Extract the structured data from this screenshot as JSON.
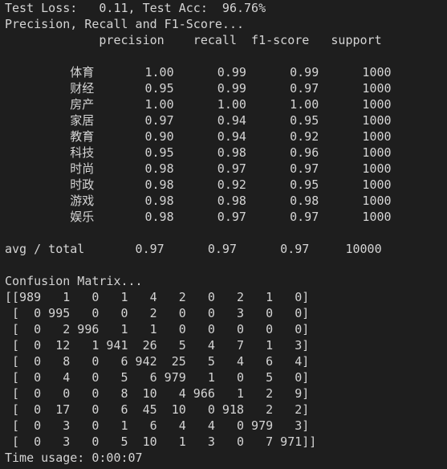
{
  "terminal": {
    "lines": [
      "Test Loss:   0.11, Test Acc:  96.76%",
      "Precision, Recall and F1-Score...",
      "             precision    recall  f1-score   support",
      "",
      "         体育       1.00      0.99      0.99      1000",
      "         财经       0.95      0.99      0.97      1000",
      "         房产       1.00      1.00      1.00      1000",
      "         家居       0.97      0.94      0.95      1000",
      "         教育       0.90      0.94      0.92      1000",
      "         科技       0.95      0.98      0.96      1000",
      "         时尚       0.98      0.97      0.97      1000",
      "         时政       0.98      0.92      0.95      1000",
      "         游戏       0.98      0.98      0.98      1000",
      "         娱乐       0.98      0.97      0.97      1000",
      "",
      "avg / total       0.97      0.97      0.97     10000",
      "",
      "Confusion Matrix...",
      "[[989   1   0   1   4   2   0   2   1   0]",
      " [  0 995   0   0   2   0   0   3   0   0]",
      " [  0   2 996   1   1   0   0   0   0   0]",
      " [  0  12   1 941  26   5   4   7   1   3]",
      " [  0   8   0   6 942  25   5   4   6   4]",
      " [  0   4   0   5   6 979   1   0   5   0]",
      " [  0   0   0   8  10   4 966   1   2   9]",
      " [  0  17   0   6  45  10   0 918   2   2]",
      " [  0   3   0   1   6   4   4   0 979   3]",
      " [  0   3   0   5  10   1   3   0   7 971]]",
      "Time usage: 0:00:07"
    ]
  }
}
